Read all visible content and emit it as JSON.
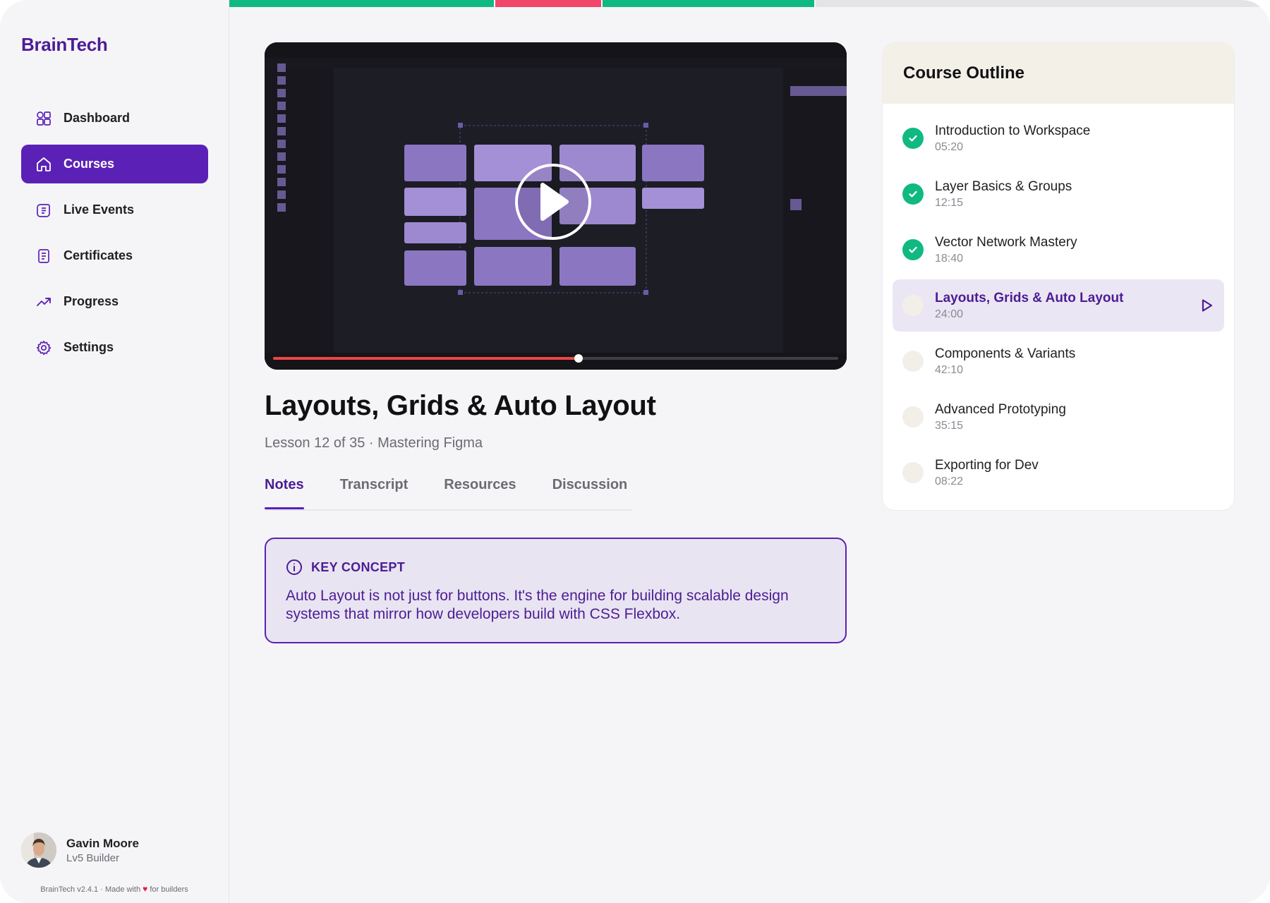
{
  "app": {
    "name": "BrainTech"
  },
  "sidebar": {
    "items": [
      {
        "label": "Dashboard",
        "icon": "dashboard-icon",
        "active": false
      },
      {
        "label": "Courses",
        "icon": "home-icon",
        "active": true
      },
      {
        "label": "Live Events",
        "icon": "live-events-icon",
        "active": false
      },
      {
        "label": "Certificates",
        "icon": "certificate-icon",
        "active": false
      },
      {
        "label": "Progress",
        "icon": "trending-up-icon",
        "active": false
      },
      {
        "label": "Settings",
        "icon": "gear-icon",
        "active": false
      }
    ]
  },
  "user": {
    "name": "Gavin Moore",
    "level": "Lv5 Builder"
  },
  "footer": {
    "prefix": "BrainTech v2.4.1 · Made with",
    "suffix": "for builders"
  },
  "top_progress": {
    "colors": [
      "#10b981",
      "#f0466a",
      "#10b981",
      "#e4e4e7"
    ]
  },
  "video": {
    "progress": 0.54,
    "played_color": "#ef4444"
  },
  "lesson": {
    "title": "Layouts, Grids & Auto Layout",
    "subtitle": "Lesson 12 of 35 · Mastering Figma"
  },
  "tabs": [
    {
      "label": "Notes",
      "active": true
    },
    {
      "label": "Transcript",
      "active": false
    },
    {
      "label": "Resources",
      "active": false
    },
    {
      "label": "Discussion",
      "active": false
    }
  ],
  "callout": {
    "label": "KEY CONCEPT",
    "body": "Auto Layout is not just for buttons. It's the engine for building scalable design systems that mirror how developers build with CSS Flexbox."
  },
  "outline": {
    "title": "Course Outline",
    "lessons": [
      {
        "title": "Introduction to Workspace",
        "duration": "05:20",
        "status": "done"
      },
      {
        "title": "Layer Basics & Groups",
        "duration": "12:15",
        "status": "done"
      },
      {
        "title": "Vector Network Mastery",
        "duration": "18:40",
        "status": "done"
      },
      {
        "title": "Layouts, Grids & Auto Layout",
        "duration": "24:00",
        "status": "current"
      },
      {
        "title": "Components & Variants",
        "duration": "42:10",
        "status": "todo"
      },
      {
        "title": "Advanced Prototyping",
        "duration": "35:15",
        "status": "todo"
      },
      {
        "title": "Exporting for Dev",
        "duration": "08:22",
        "status": "todo"
      }
    ]
  },
  "colors": {
    "brand": "#5b21b6",
    "brand_dark": "#4c1d95",
    "success": "#10b981",
    "accent_red": "#f0466a"
  }
}
